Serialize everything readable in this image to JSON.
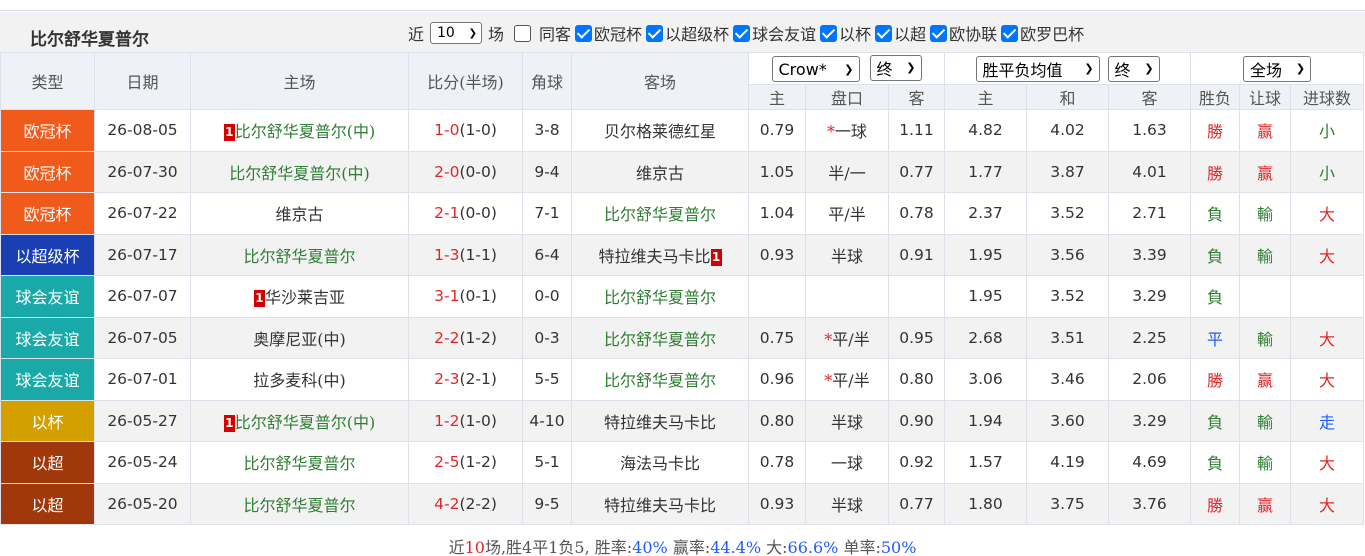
{
  "team_title": "比尔舒华夏普尔",
  "filters": {
    "recent_prefix": "近",
    "recent_count": "10",
    "recent_suffix": "场",
    "checkboxes": [
      {
        "label": "同客",
        "checked": false
      },
      {
        "label": "欧冠杯",
        "checked": true
      },
      {
        "label": "以超级杯",
        "checked": true
      },
      {
        "label": "球会友谊",
        "checked": true
      },
      {
        "label": "以杯",
        "checked": true
      },
      {
        "label": "以超",
        "checked": true
      },
      {
        "label": "欧协联",
        "checked": true
      },
      {
        "label": "欧罗巴杯",
        "checked": true
      }
    ]
  },
  "header": {
    "type": "类型",
    "date": "日期",
    "home": "主场",
    "score": "比分(半场)",
    "corner": "角球",
    "away": "客场",
    "company_select": "Crow*",
    "handicap_period_select": "终",
    "odds_type_select": "胜平负均值",
    "odds_period_select": "终",
    "scope_select": "全场",
    "sub": {
      "h_home": "主",
      "h_line": "盘口",
      "h_away": "客",
      "o_home": "主",
      "o_draw": "和",
      "o_away": "客",
      "result": "胜负",
      "handicap_result": "让球",
      "goals": "进球数"
    }
  },
  "colors": {
    "欧冠杯": "#f05a1a",
    "以超级杯": "#1a3fb5",
    "球会友谊": "#19a9a9",
    "以杯": "#d4a000",
    "以超": "#a1380c"
  },
  "rows": [
    {
      "type": "欧冠杯",
      "date": "26-08-05",
      "home_rank": "1",
      "home": "比尔舒华夏普尔(中)",
      "home_is_team": true,
      "score": "1-0",
      "half": "(1-0)",
      "corner": "3-8",
      "away_rank": "",
      "away": "贝尔格莱德红星",
      "away_is_team": false,
      "h_home": "0.79",
      "h_star": "*",
      "h_line": "一球",
      "h_away": "1.11",
      "o_home": "4.82",
      "o_draw": "4.02",
      "o_away": "1.63",
      "result": "勝",
      "result_color": "red",
      "handicap": "赢",
      "handicap_color": "red",
      "goals": "小",
      "goals_color": "green"
    },
    {
      "type": "欧冠杯",
      "date": "26-07-30",
      "home_rank": "",
      "home": "比尔舒华夏普尔(中)",
      "home_is_team": true,
      "score": "2-0",
      "half": "(0-0)",
      "corner": "9-4",
      "away_rank": "",
      "away": "维京古",
      "away_is_team": false,
      "h_home": "1.05",
      "h_star": "",
      "h_line": "半/一",
      "h_away": "0.77",
      "o_home": "1.77",
      "o_draw": "3.87",
      "o_away": "4.01",
      "result": "勝",
      "result_color": "red",
      "handicap": "赢",
      "handicap_color": "red",
      "goals": "小",
      "goals_color": "green"
    },
    {
      "type": "欧冠杯",
      "date": "26-07-22",
      "home_rank": "",
      "home": "维京古",
      "home_is_team": false,
      "score": "2-1",
      "half": "(0-0)",
      "corner": "7-1",
      "away_rank": "",
      "away": "比尔舒华夏普尔",
      "away_is_team": true,
      "h_home": "1.04",
      "h_star": "",
      "h_line": "平/半",
      "h_away": "0.78",
      "o_home": "2.37",
      "o_draw": "3.52",
      "o_away": "2.71",
      "result": "負",
      "result_color": "green",
      "handicap": "輸",
      "handicap_color": "green",
      "goals": "大",
      "goals_color": "red"
    },
    {
      "type": "以超级杯",
      "date": "26-07-17",
      "home_rank": "",
      "home": "比尔舒华夏普尔",
      "home_is_team": true,
      "score": "1-3",
      "half": "(1-1)",
      "corner": "6-4",
      "away_rank": "1",
      "away": "特拉维夫马卡比",
      "away_is_team": false,
      "h_home": "0.93",
      "h_star": "",
      "h_line": "半球",
      "h_away": "0.91",
      "o_home": "1.95",
      "o_draw": "3.56",
      "o_away": "3.39",
      "result": "負",
      "result_color": "green",
      "handicap": "輸",
      "handicap_color": "green",
      "goals": "大",
      "goals_color": "red"
    },
    {
      "type": "球会友谊",
      "date": "26-07-07",
      "home_rank": "1",
      "home": "华沙莱吉亚",
      "home_is_team": false,
      "score": "3-1",
      "half": "(0-1)",
      "corner": "0-0",
      "away_rank": "",
      "away": "比尔舒华夏普尔",
      "away_is_team": true,
      "h_home": "",
      "h_star": "",
      "h_line": "",
      "h_away": "",
      "o_home": "1.95",
      "o_draw": "3.52",
      "o_away": "3.29",
      "result": "負",
      "result_color": "green",
      "handicap": "",
      "handicap_color": "green",
      "goals": "",
      "goals_color": "red"
    },
    {
      "type": "球会友谊",
      "date": "26-07-05",
      "home_rank": "",
      "home": "奥摩尼亚(中)",
      "home_is_team": false,
      "score": "2-2",
      "half": "(1-2)",
      "corner": "0-3",
      "away_rank": "",
      "away": "比尔舒华夏普尔",
      "away_is_team": true,
      "h_home": "0.75",
      "h_star": "*",
      "h_line": "平/半",
      "h_away": "0.95",
      "o_home": "2.68",
      "o_draw": "3.51",
      "o_away": "2.25",
      "result": "平",
      "result_color": "blue",
      "handicap": "輸",
      "handicap_color": "green",
      "goals": "大",
      "goals_color": "red"
    },
    {
      "type": "球会友谊",
      "date": "26-07-01",
      "home_rank": "",
      "home": "拉多麦科(中)",
      "home_is_team": false,
      "score": "2-3",
      "half": "(2-1)",
      "corner": "5-5",
      "away_rank": "",
      "away": "比尔舒华夏普尔",
      "away_is_team": true,
      "h_home": "0.96",
      "h_star": "*",
      "h_line": "平/半",
      "h_away": "0.80",
      "o_home": "3.06",
      "o_draw": "3.46",
      "o_away": "2.06",
      "result": "勝",
      "result_color": "red",
      "handicap": "赢",
      "handicap_color": "red",
      "goals": "大",
      "goals_color": "red"
    },
    {
      "type": "以杯",
      "date": "26-05-27",
      "home_rank": "1",
      "home": "比尔舒华夏普尔(中)",
      "home_is_team": true,
      "score": "1-2",
      "half": "(1-0)",
      "corner": "4-10",
      "away_rank": "",
      "away": "特拉维夫马卡比",
      "away_is_team": false,
      "h_home": "0.80",
      "h_star": "",
      "h_line": "半球",
      "h_away": "0.90",
      "o_home": "1.94",
      "o_draw": "3.60",
      "o_away": "3.29",
      "result": "負",
      "result_color": "green",
      "handicap": "輸",
      "handicap_color": "green",
      "goals": "走",
      "goals_color": "blue"
    },
    {
      "type": "以超",
      "date": "26-05-24",
      "home_rank": "",
      "home": "比尔舒华夏普尔",
      "home_is_team": true,
      "score": "2-5",
      "half": "(1-2)",
      "corner": "5-1",
      "away_rank": "",
      "away": "海法马卡比",
      "away_is_team": false,
      "h_home": "0.78",
      "h_star": "",
      "h_line": "一球",
      "h_away": "0.92",
      "o_home": "1.57",
      "o_draw": "4.19",
      "o_away": "4.69",
      "result": "負",
      "result_color": "green",
      "handicap": "輸",
      "handicap_color": "green",
      "goals": "大",
      "goals_color": "red"
    },
    {
      "type": "以超",
      "date": "26-05-20",
      "home_rank": "",
      "home": "比尔舒华夏普尔",
      "home_is_team": true,
      "score": "4-2",
      "half": "(2-2)",
      "corner": "9-5",
      "away_rank": "",
      "away": "特拉维夫马卡比",
      "away_is_team": false,
      "h_home": "0.93",
      "h_star": "",
      "h_line": "半球",
      "h_away": "0.77",
      "o_home": "1.80",
      "o_draw": "3.75",
      "o_away": "3.76",
      "result": "勝",
      "result_color": "red",
      "handicap": "赢",
      "handicap_color": "red",
      "goals": "大",
      "goals_color": "red"
    }
  ],
  "summary": {
    "p1": "近",
    "games": "10",
    "p2": "场,胜4平1负5, 胜率:",
    "win_rate": "40%",
    "p3": " 赢率:",
    "cover_rate": "44.4%",
    "p4": " 大:",
    "over_rate": "66.6%",
    "p5": " 单率:",
    "odd_rate": "50%"
  }
}
